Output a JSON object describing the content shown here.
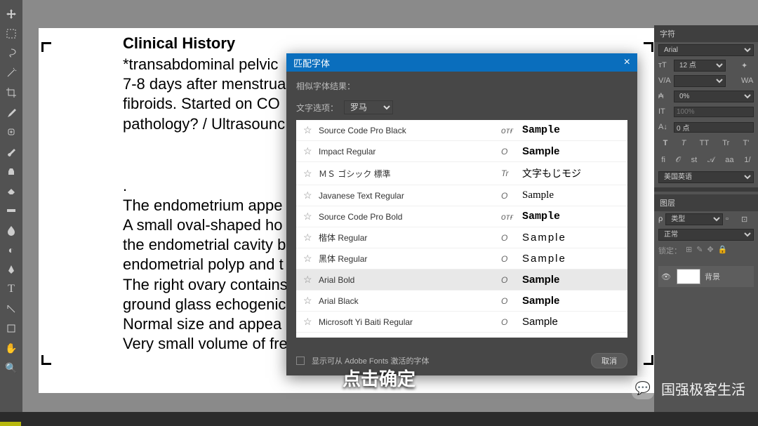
{
  "toolbar": {
    "tools": [
      "move",
      "marquee",
      "lasso",
      "wand",
      "crop",
      "eyedropper",
      "healing",
      "brush",
      "clone",
      "eraser",
      "gradient",
      "blur",
      "dodge",
      "pen",
      "type",
      "pointer",
      "hand",
      "shape",
      "zoom"
    ]
  },
  "document": {
    "title": "Clinical History",
    "block1": "*transabdominal pelvic\n7-8 days after menstrua\nfibroids. Started on CO\npathology? / Ultrasounc",
    "block2": ".\nThe endometrium appe\nA small oval-shaped ho\nthe endometrial cavity b\nendometrial polyp and t\nThe right ovary contains\nground glass echogenic\nNormal size and appea\nVery small volume of fre"
  },
  "dialog": {
    "title": "匹配字体",
    "close": "×",
    "similar_label": "相似字体结果：",
    "option_label": "文字选项：",
    "option_value": "罗马",
    "fonts": [
      {
        "name": "Source Code Pro Black",
        "type": "ᴏᴛғ",
        "sample": "Sample",
        "class": "mono"
      },
      {
        "name": "Impact Regular",
        "type": "O",
        "sample": "Sample",
        "class": "bold"
      },
      {
        "name": "ＭＳ ゴシック 標準",
        "type": "Tr",
        "sample": "文字もじモジ",
        "class": "cjk"
      },
      {
        "name": "Javanese Text Regular",
        "type": "O",
        "sample": "Sample",
        "class": "serif"
      },
      {
        "name": "Source Code Pro Bold",
        "type": "ᴏᴛғ",
        "sample": "Sample",
        "class": "mono"
      },
      {
        "name": "楷体 Regular",
        "type": "O",
        "sample": "Sample",
        "class": "spaced"
      },
      {
        "name": "黑体 Regular",
        "type": "O",
        "sample": "Sample",
        "class": "spaced"
      },
      {
        "name": "Arial Bold",
        "type": "O",
        "sample": "Sample",
        "class": "arialbold",
        "selected": true
      },
      {
        "name": "Arial Black",
        "type": "O",
        "sample": "Sample",
        "class": "black"
      },
      {
        "name": "Microsoft Yi Baiti Regular",
        "type": "O",
        "sample": "Sample",
        "class": ""
      }
    ],
    "footer_label": "显示可从 Adobe Fonts 激活的字体",
    "cancel": "取消"
  },
  "panels": {
    "char": {
      "tab": "字符",
      "font": "Arial",
      "size": "12 点",
      "leading_icon": "✦",
      "tracking": "",
      "kerning": "0%",
      "scale": "100%",
      "baseline_icon": "A↓",
      "baseline": "0 点",
      "lang": "美国英语",
      "type_btns": [
        "T",
        "T",
        "TT",
        "Tr",
        "T'"
      ],
      "ot_btns": [
        "fi",
        "𝒪",
        "st",
        "𝒜",
        "aa",
        "1/"
      ]
    },
    "layers": {
      "tab": "图层",
      "kind": "类型",
      "mode": "正常",
      "lock": "锁定：",
      "bg": "背景"
    }
  },
  "caption": "点击确定",
  "watermark": "国强极客生活"
}
